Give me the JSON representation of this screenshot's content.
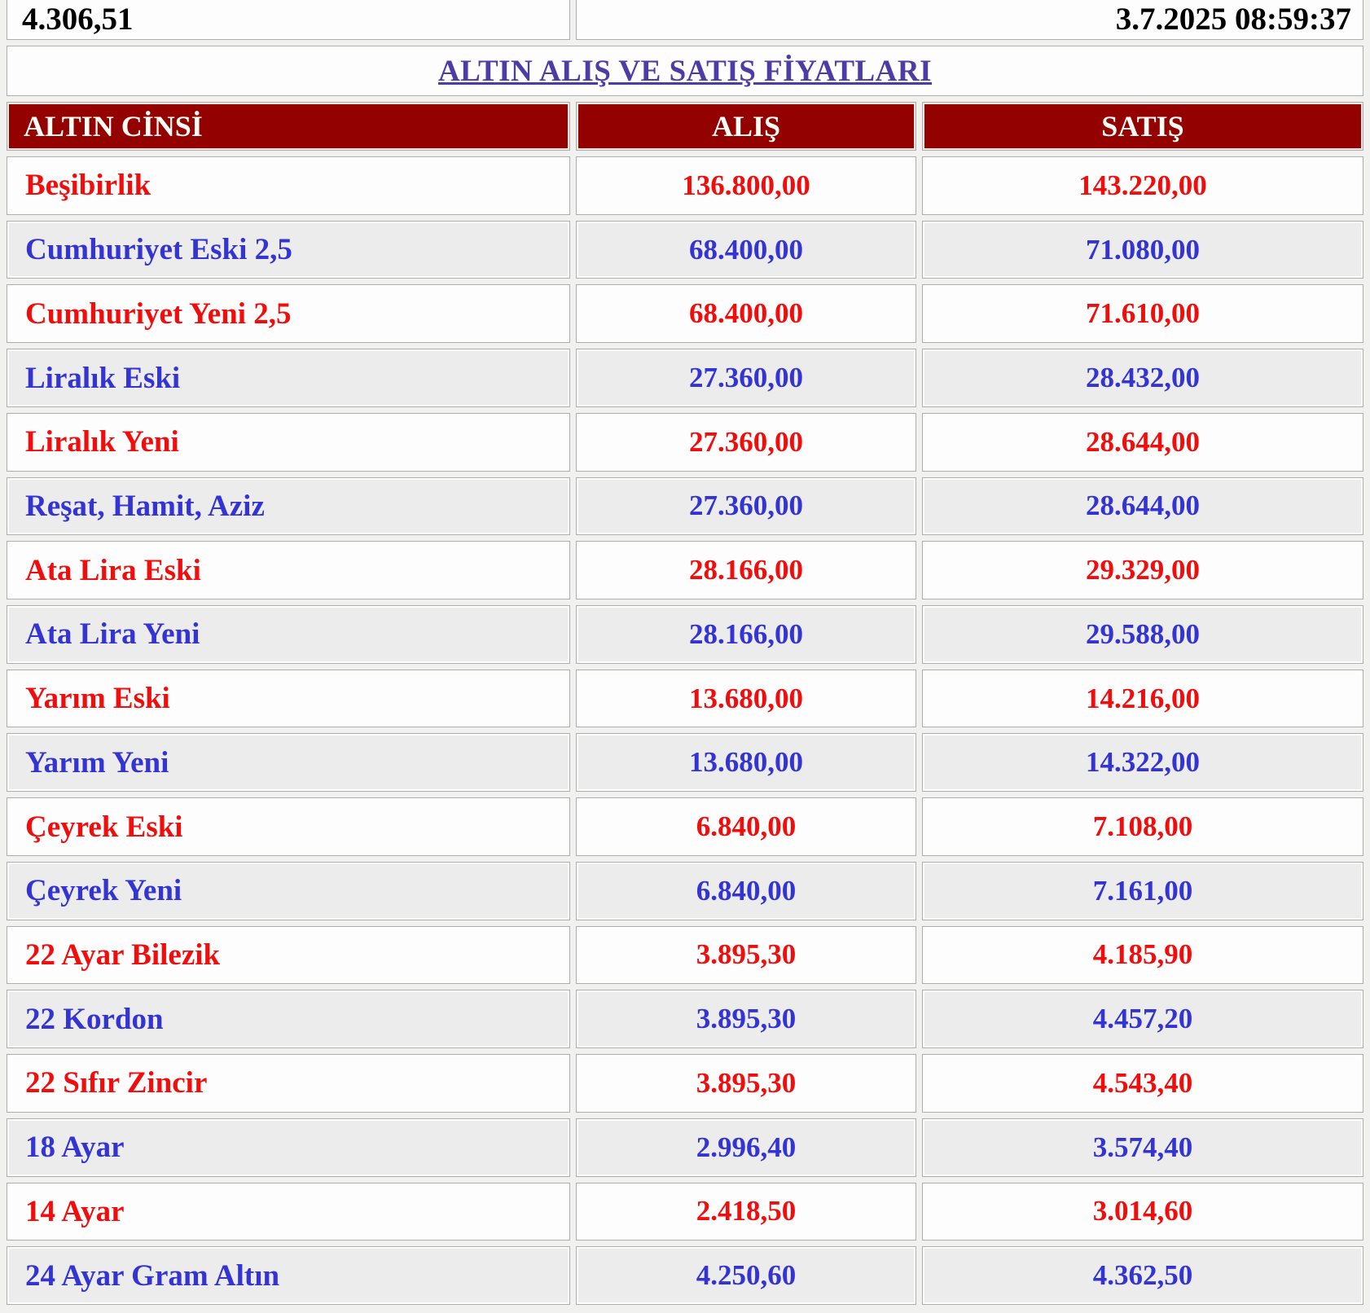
{
  "topbar": {
    "left_value": "4.306,51",
    "timestamp": "3.7.2025 08:59:37"
  },
  "title": "ALTIN ALIŞ VE SATIŞ FİYATLARI",
  "table": {
    "headers": {
      "type": "ALTIN CİNSİ",
      "buy": "ALIŞ",
      "sell": "SATIŞ"
    },
    "rows": [
      {
        "name": "Beşibirlik",
        "buy": "136.800,00",
        "sell": "143.220,00"
      },
      {
        "name": "Cumhuriyet Eski 2,5",
        "buy": "68.400,00",
        "sell": "71.080,00"
      },
      {
        "name": "Cumhuriyet Yeni 2,5",
        "buy": "68.400,00",
        "sell": "71.610,00"
      },
      {
        "name": "Liralık Eski",
        "buy": "27.360,00",
        "sell": "28.432,00"
      },
      {
        "name": "Liralık Yeni",
        "buy": "27.360,00",
        "sell": "28.644,00"
      },
      {
        "name": "Reşat, Hamit, Aziz",
        "buy": "27.360,00",
        "sell": "28.644,00"
      },
      {
        "name": "Ata Lira Eski",
        "buy": "28.166,00",
        "sell": "29.329,00"
      },
      {
        "name": "Ata Lira Yeni",
        "buy": "28.166,00",
        "sell": "29.588,00"
      },
      {
        "name": "Yarım Eski",
        "buy": "13.680,00",
        "sell": "14.216,00"
      },
      {
        "name": "Yarım Yeni",
        "buy": "13.680,00",
        "sell": "14.322,00"
      },
      {
        "name": "Çeyrek Eski",
        "buy": "6.840,00",
        "sell": "7.108,00"
      },
      {
        "name": "Çeyrek Yeni",
        "buy": "6.840,00",
        "sell": "7.161,00"
      },
      {
        "name": "22 Ayar Bilezik",
        "buy": "3.895,30",
        "sell": "4.185,90"
      },
      {
        "name": "22 Kordon",
        "buy": "3.895,30",
        "sell": "4.457,20"
      },
      {
        "name": "22 Sıfır Zincir",
        "buy": "3.895,30",
        "sell": "4.543,40"
      },
      {
        "name": "18 Ayar",
        "buy": "2.996,40",
        "sell": "3.574,40"
      },
      {
        "name": "14 Ayar",
        "buy": "2.418,50",
        "sell": "3.014,60"
      },
      {
        "name": "24 Ayar Gram Altın",
        "buy": "4.250,60",
        "sell": "4.362,50"
      }
    ]
  },
  "colors": {
    "header_bg": "#930101",
    "row_red": "#f20d0d",
    "row_blue": "#3434d4",
    "title_link": "#4e3ca6",
    "row_alt_bg": "#ececec",
    "value_black": "#000000"
  }
}
